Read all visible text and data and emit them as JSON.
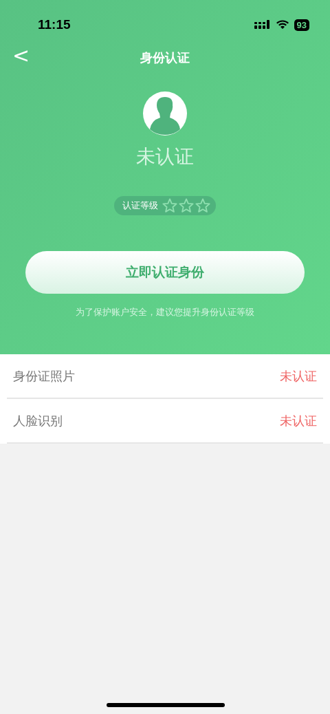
{
  "status_bar": {
    "time": "11:15",
    "battery": "93"
  },
  "nav": {
    "back": "<",
    "title": "身份认证"
  },
  "profile": {
    "status": "未认证",
    "level_label": "认证等级",
    "stars": 0
  },
  "verify_button": "立即认证身份",
  "hint": "为了保护账户安全，建议您提升身份认证等级",
  "items": [
    {
      "label": "身份证照片",
      "status": "未认证"
    },
    {
      "label": "人脸识别",
      "status": "未认证"
    }
  ]
}
